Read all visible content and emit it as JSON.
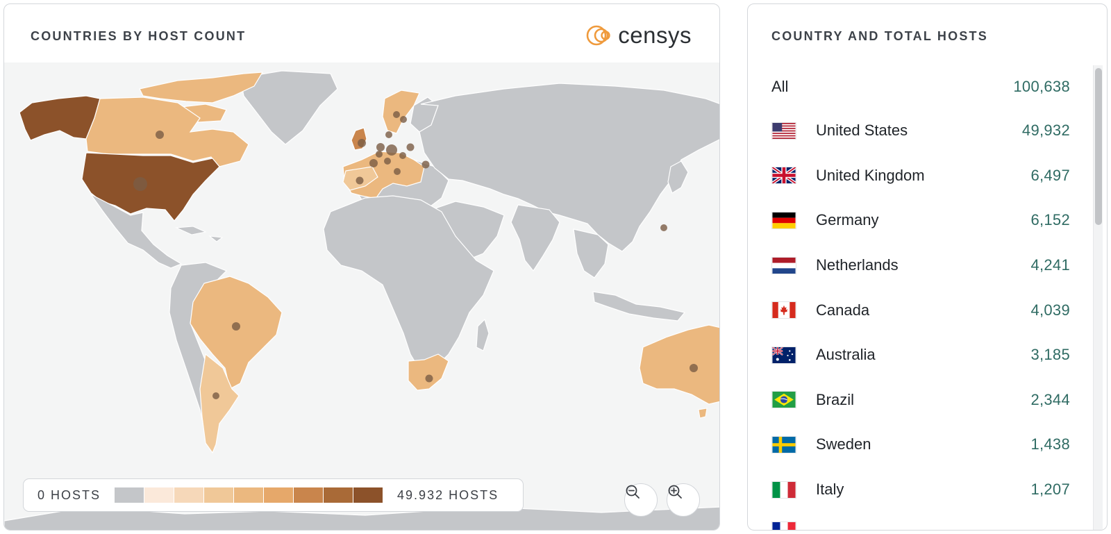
{
  "map_card": {
    "title": "COUNTRIES BY HOST COUNT",
    "logo_text": "censys",
    "legend": {
      "min_label": "0 HOSTS",
      "max_label": "49.932 HOSTS",
      "scale_colors": [
        "#c4c6c9",
        "#fbe9da",
        "#f6d8b9",
        "#f0c898",
        "#ebb87f",
        "#e6a86a",
        "#c9854c",
        "#a96a37",
        "#8c522a"
      ]
    },
    "zoom_out_label": "zoom out",
    "zoom_in_label": "zoom in"
  },
  "colors": {
    "ocean": "#f4f5f5",
    "land_default": "#c4c6c9",
    "marker": "#7a5c45",
    "accent_count": "#2f6b63",
    "logo_orange": "#ef9a3c"
  },
  "list_card": {
    "title": "COUNTRY AND TOTAL HOSTS",
    "all": {
      "label": "All",
      "count": "100,638"
    },
    "countries": [
      {
        "name": "United States",
        "count": "49,932",
        "flag": "us-flag-icon"
      },
      {
        "name": "United Kingdom",
        "count": "6,497",
        "flag": "uk-flag-icon"
      },
      {
        "name": "Germany",
        "count": "6,152",
        "flag": "de-flag-icon"
      },
      {
        "name": "Netherlands",
        "count": "4,241",
        "flag": "nl-flag-icon"
      },
      {
        "name": "Canada",
        "count": "4,039",
        "flag": "ca-flag-icon"
      },
      {
        "name": "Australia",
        "count": "3,185",
        "flag": "au-flag-icon"
      },
      {
        "name": "Brazil",
        "count": "2,344",
        "flag": "br-flag-icon"
      },
      {
        "name": "Sweden",
        "count": "1,438",
        "flag": "se-flag-icon"
      },
      {
        "name": "Italy",
        "count": "1,207",
        "flag": "it-flag-icon"
      }
    ]
  },
  "map_regions": [
    {
      "id": "alaska",
      "fill": "#8c522a"
    },
    {
      "id": "canada",
      "fill": "#ebb87f"
    },
    {
      "id": "usa",
      "fill": "#8c522a"
    },
    {
      "id": "brazil",
      "fill": "#ebb87f"
    },
    {
      "id": "argentina",
      "fill": "#f0c898"
    },
    {
      "id": "south-africa",
      "fill": "#ebb87f"
    },
    {
      "id": "australia",
      "fill": "#ebb87f"
    },
    {
      "id": "western-europe",
      "fill": "#ebb87f"
    }
  ]
}
